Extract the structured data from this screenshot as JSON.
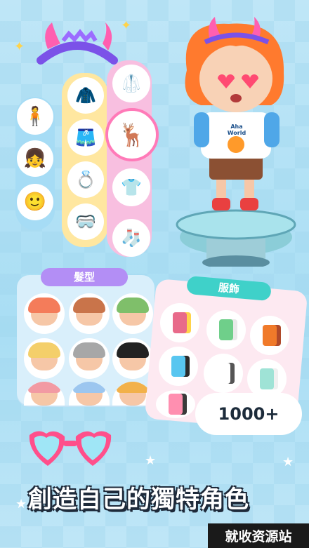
{
  "hairstyle_tag": "髮型",
  "outfit_tag": "服飾",
  "badge": "1000+",
  "banner": "創造自己的獨特角色",
  "watermark": "就收资源站",
  "shirt_text_line1": "Aha",
  "shirt_text_line2": "World",
  "colors": {
    "background": "#b6e3f6",
    "hair_panel": "#d9effb",
    "outfit_panel": "#fde9f1",
    "hair_tag": "#b38ef5",
    "outfit_tag": "#3fd1c9",
    "pill_blue": "#a6dcf5",
    "pill_yellow": "#ffe7a0",
    "pill_pink": "#f8bfe0"
  }
}
